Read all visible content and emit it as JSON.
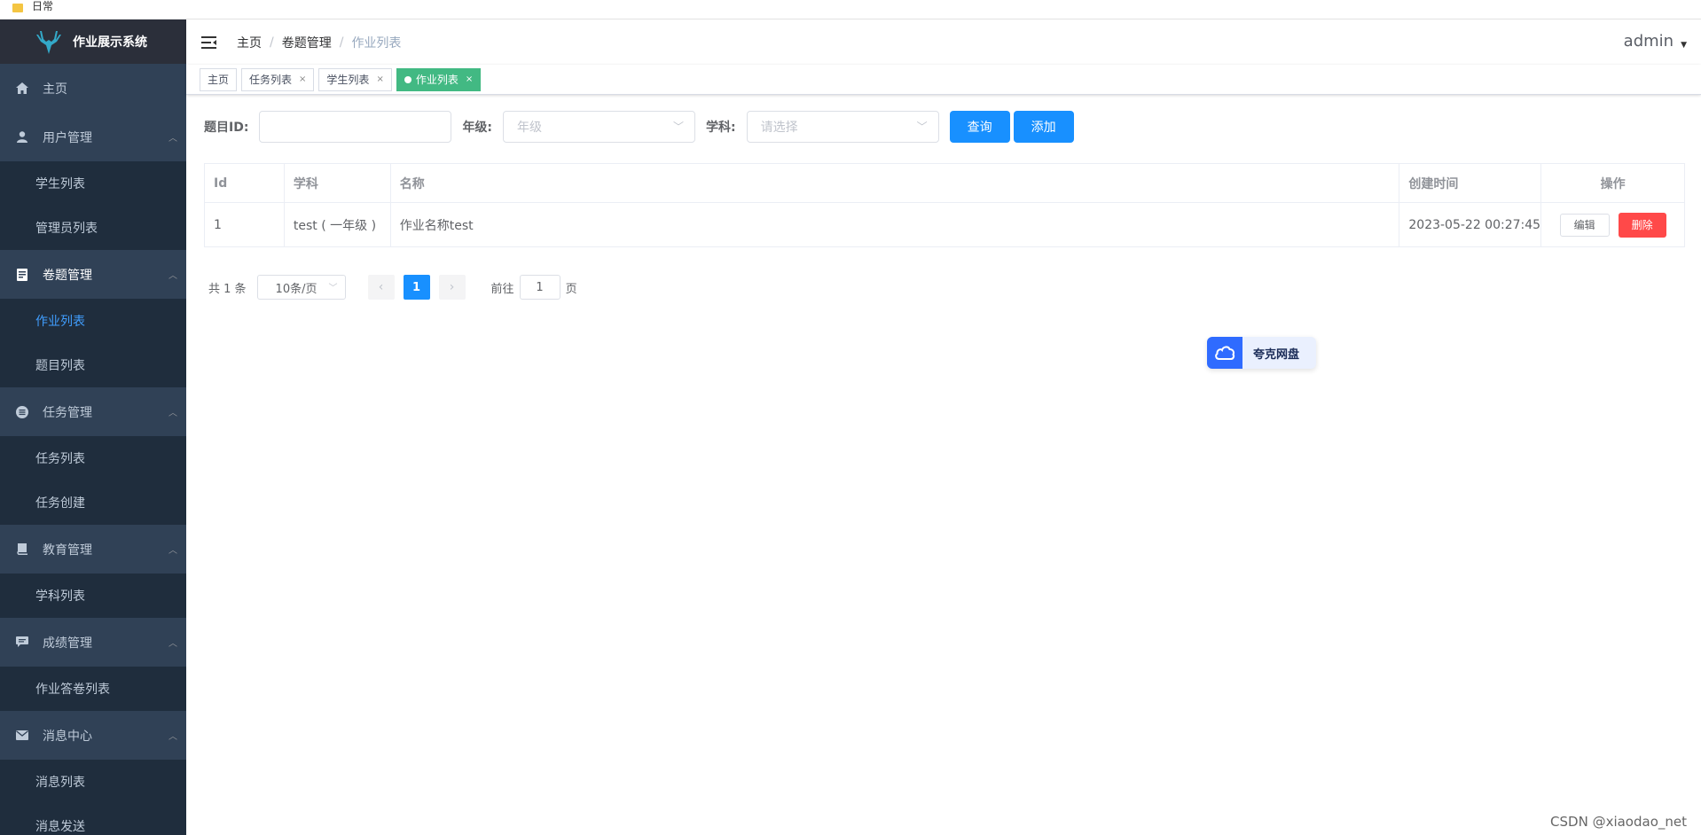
{
  "browser": {
    "bookmark": "日常"
  },
  "sidebar": {
    "app_title": "作业展示系统",
    "groups": [
      {
        "label": "主页",
        "icon": "home-icon",
        "items": []
      },
      {
        "label": "用户管理",
        "icon": "user-icon",
        "items": [
          "学生列表",
          "管理员列表"
        ]
      },
      {
        "label": "卷题管理",
        "icon": "document-icon",
        "items": [
          "作业列表",
          "题目列表"
        ]
      },
      {
        "label": "任务管理",
        "icon": "list-circle-icon",
        "items": [
          "任务列表",
          "任务创建"
        ]
      },
      {
        "label": "教育管理",
        "icon": "book-icon",
        "items": [
          "学科列表"
        ]
      },
      {
        "label": "成绩管理",
        "icon": "chat-icon",
        "items": [
          "作业答卷列表"
        ]
      },
      {
        "label": "消息中心",
        "icon": "mail-icon",
        "items": [
          "消息列表",
          "消息发送"
        ]
      }
    ]
  },
  "navbar": {
    "breadcrumb": [
      "主页",
      "卷题管理",
      "作业列表"
    ],
    "user": "admin"
  },
  "tags": [
    {
      "label": "主页",
      "closable": false,
      "active": false
    },
    {
      "label": "任务列表",
      "closable": true,
      "active": false
    },
    {
      "label": "学生列表",
      "closable": true,
      "active": false
    },
    {
      "label": "作业列表",
      "closable": true,
      "active": true
    }
  ],
  "filter": {
    "id_label": "题目ID:",
    "id_value": "",
    "grade_label": "年级:",
    "grade_placeholder": "年级",
    "subject_label": "学科:",
    "subject_placeholder": "请选择",
    "query_button": "查询",
    "add_button": "添加"
  },
  "table": {
    "columns": [
      "Id",
      "学科",
      "名称",
      "创建时间",
      "操作"
    ],
    "rows": [
      {
        "id": "1",
        "subject": "test ( 一年级 )",
        "name": "作业名称test",
        "created": "2023-05-22 00:27:45"
      }
    ],
    "edit_label": "编辑",
    "delete_label": "删除"
  },
  "pagination": {
    "total_text": "共 1 条",
    "page_size": "10条/页",
    "current_page": "1",
    "goto_prefix": "前往",
    "goto_value": "1",
    "goto_suffix": "页"
  },
  "overlay": {
    "quark_label": "夸克网盘"
  },
  "watermark": "CSDN @xiaodao_net",
  "colors": {
    "sidebar_bg": "#1f2d3d",
    "primary": "#1890ff",
    "tag_active": "#42b983",
    "danger": "#ff4949",
    "submenu_active": "#409eff"
  }
}
